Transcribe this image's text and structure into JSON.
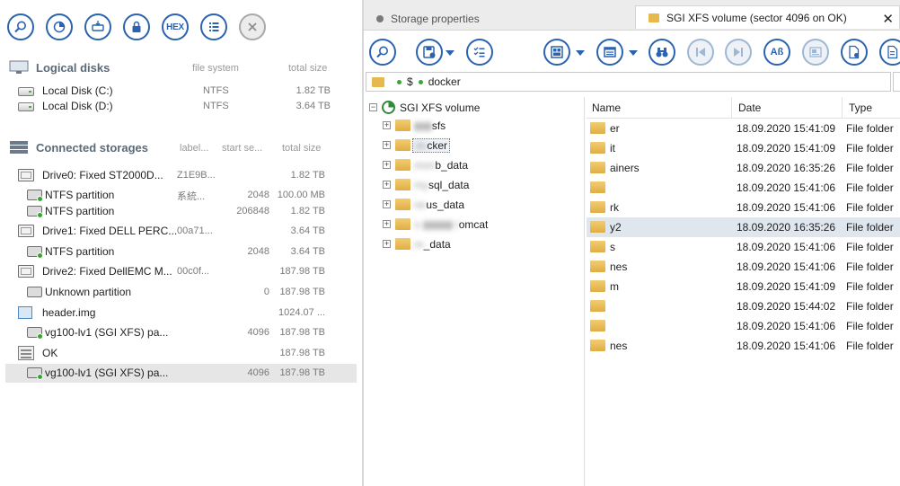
{
  "left_toolbar": {
    "buttons": [
      {
        "name": "search-icon"
      },
      {
        "name": "pie-chart-icon"
      },
      {
        "name": "disk-image-icon"
      },
      {
        "name": "lock-icon"
      },
      {
        "name": "hex-icon",
        "label": "HEX"
      },
      {
        "name": "list-icon"
      },
      {
        "name": "close-icon"
      }
    ]
  },
  "logical_disks": {
    "title": "Logical disks",
    "col_fs": "file system",
    "col_size": "total size",
    "items": [
      {
        "name": "Local Disk (C:)",
        "fs": "NTFS",
        "size": "1.82 TB"
      },
      {
        "name": "Local Disk (D:)",
        "fs": "NTFS",
        "size": "3.64 TB"
      }
    ]
  },
  "connected_storages": {
    "title": "Connected storages",
    "col_label": "label...",
    "col_start": "start se...",
    "col_size": "total size",
    "items": [
      {
        "kind": "drive",
        "name": "Drive0: Fixed ST2000D...",
        "label": "Z1E9B...",
        "start": "",
        "size": "1.82 TB"
      },
      {
        "kind": "part",
        "name": "NTFS partition",
        "label": "系統...",
        "start": "2048",
        "size": "100.00 MB"
      },
      {
        "kind": "part",
        "name": "NTFS partition",
        "label": "",
        "start": "206848",
        "size": "1.82 TB"
      },
      {
        "kind": "drive",
        "name": "Drive1: Fixed DELL PERC...",
        "label": "00a71...",
        "start": "",
        "size": "3.64 TB"
      },
      {
        "kind": "part",
        "name": "NTFS partition",
        "label": "",
        "start": "2048",
        "size": "3.64 TB"
      },
      {
        "kind": "drive",
        "name": "Drive2: Fixed DellEMC M...",
        "label": "00c0f...",
        "start": "",
        "size": "187.98 TB"
      },
      {
        "kind": "part-plain",
        "name": "Unknown partition",
        "label": "",
        "start": "0",
        "size": "187.98 TB"
      },
      {
        "kind": "image",
        "name": "header.img",
        "label": "",
        "start": "",
        "size": "1024.07 ..."
      },
      {
        "kind": "part",
        "name": "vg100-lv1 (SGI XFS) pa...",
        "label": "",
        "start": "4096",
        "size": "187.98 TB"
      },
      {
        "kind": "ok",
        "name": "OK",
        "label": "",
        "start": "",
        "size": "187.98 TB"
      },
      {
        "kind": "part",
        "name": "vg100-lv1 (SGI XFS) pa...",
        "label": "",
        "start": "4096",
        "size": "187.98 TB",
        "selected": true
      }
    ]
  },
  "tabs": [
    {
      "label": "Storage properties",
      "active": false
    },
    {
      "label": "SGI XFS volume (sector 4096 on OK)",
      "active": true,
      "close": "✕"
    }
  ],
  "path": {
    "root": "$",
    "current": "docker"
  },
  "tree": {
    "root": "SGI XFS volume",
    "children": [
      {
        "label": "sfs",
        "blurred_prefix": "▮▮▮",
        "selected": false
      },
      {
        "label": "cker",
        "blurred_prefix": "do",
        "selected": true
      },
      {
        "label": "b_data",
        "blurred_prefix": "mon",
        "selected": false
      },
      {
        "label": "sql_data",
        "blurred_prefix": "my",
        "selected": false
      },
      {
        "label": "us_data",
        "blurred_prefix": "ne",
        "selected": false
      },
      {
        "label": "omcat",
        "blurred_prefix": "o ▮▮▮▮▮ t",
        "selected": false
      },
      {
        "label": "_data",
        "blurred_prefix": "re",
        "selected": false
      }
    ]
  },
  "file_list": {
    "headers": {
      "name": "Name",
      "date": "Date",
      "type": "Type"
    },
    "rows": [
      {
        "name": "er",
        "date": "18.09.2020 15:41:09",
        "type": "File folder"
      },
      {
        "name": "it",
        "date": "18.09.2020 15:41:09",
        "type": "File folder"
      },
      {
        "name": "ainers",
        "date": "18.09.2020 16:35:26",
        "type": "File folder"
      },
      {
        "name": "",
        "date": "18.09.2020 15:41:06",
        "type": "File folder"
      },
      {
        "name": "rk",
        "date": "18.09.2020 15:41:06",
        "type": "File folder"
      },
      {
        "name": "y2",
        "date": "18.09.2020 16:35:26",
        "type": "File folder",
        "selected": true
      },
      {
        "name": "s",
        "date": "18.09.2020 15:41:06",
        "type": "File folder"
      },
      {
        "name": "nes",
        "date": "18.09.2020 15:41:06",
        "type": "File folder"
      },
      {
        "name": "m",
        "date": "18.09.2020 15:41:09",
        "type": "File folder"
      },
      {
        "name": "",
        "date": "18.09.2020 15:44:02",
        "type": "File folder"
      },
      {
        "name": "",
        "date": "18.09.2020 15:41:06",
        "type": "File folder"
      },
      {
        "name": "nes",
        "date": "18.09.2020 15:41:06",
        "type": "File folder"
      }
    ]
  },
  "colors": {
    "accent": "#2b63b0",
    "folder": "#e7b94d",
    "selection": "#e6e6e6"
  }
}
